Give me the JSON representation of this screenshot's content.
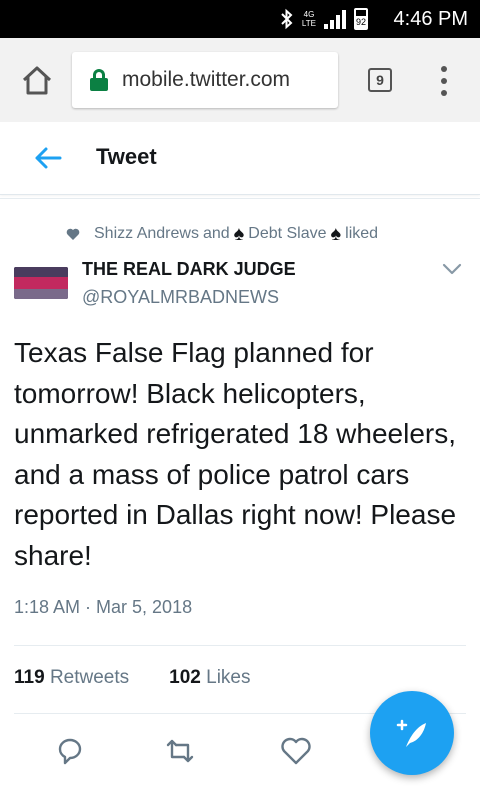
{
  "status_bar": {
    "time": "4:46 PM",
    "network": "4G",
    "network_sub": "LTE",
    "battery": "92",
    "icons": [
      "bluetooth-icon",
      "signal-icon",
      "battery-icon"
    ]
  },
  "browser": {
    "url": "mobile.twitter.com",
    "tab_count": "9",
    "icons": [
      "home-icon",
      "lock-icon",
      "menu-icon"
    ]
  },
  "header": {
    "title": "Tweet"
  },
  "tweet": {
    "social_context": {
      "user1": "Shizz Andrews",
      "and": "and",
      "user2": "Debt Slave",
      "liked": "liked"
    },
    "author_name": "THE REAL DARK JUDGE",
    "author_handle": "@ROYALMRBADNEWS",
    "text": "Texas False Flag planned for tomorrow! Black helicopters, unmarked  refrigerated 18 wheelers, and a mass of police patrol cars reported in  Dallas right now! Please share!",
    "timestamp": "1:18 AM · Mar 5, 2018",
    "retweets_count": "119",
    "retweets_label": "Retweets",
    "likes_count": "102",
    "likes_label": "Likes"
  },
  "colors": {
    "accent": "#1da1f2",
    "text": "#14171a",
    "secondary": "#657786",
    "lock": "#0b8043"
  }
}
